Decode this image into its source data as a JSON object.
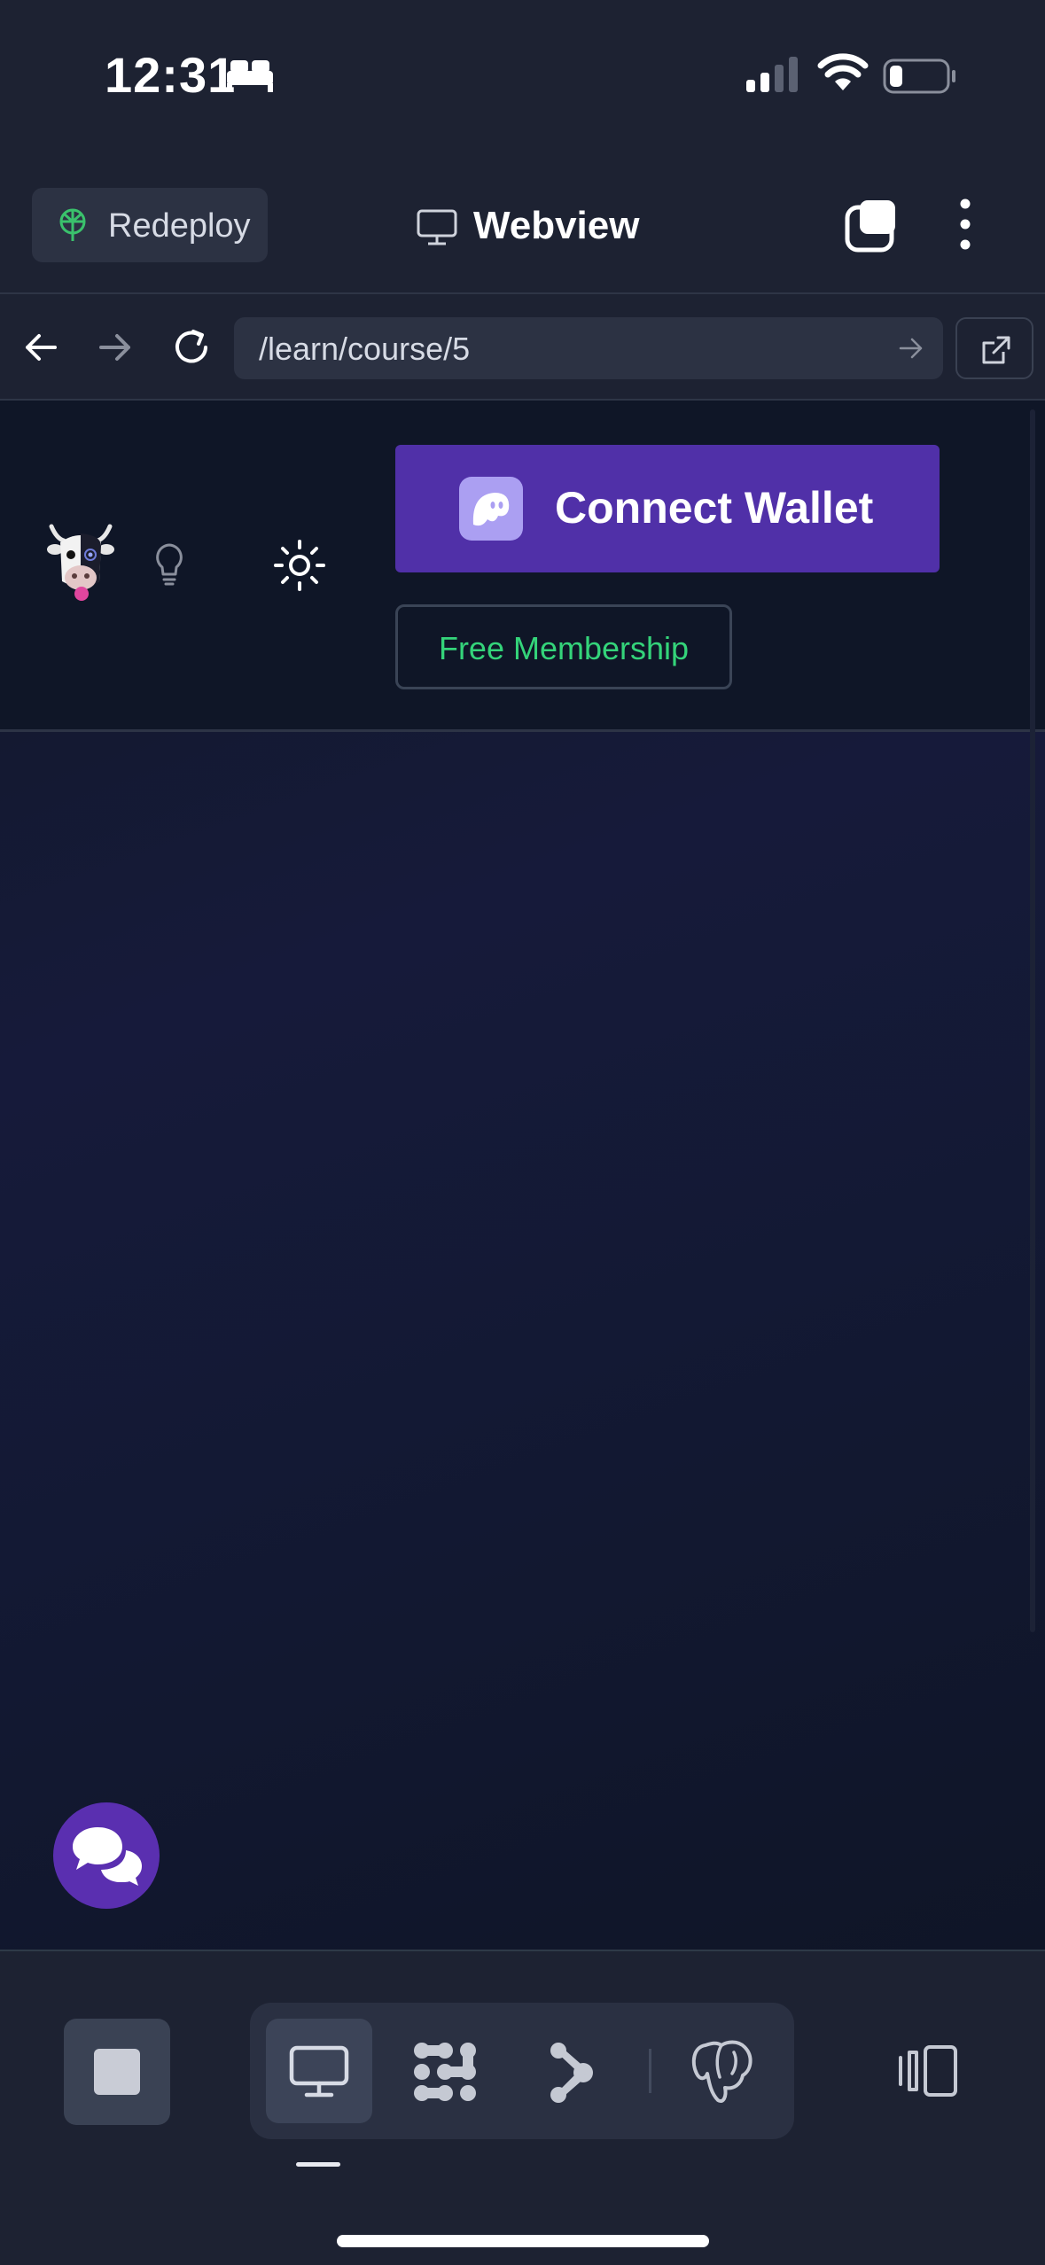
{
  "status_bar": {
    "time": "12:31",
    "focus_icon": "bed-icon",
    "signal_icon": "cellular-signal-icon",
    "wifi_icon": "wifi-icon",
    "battery_icon": "battery-low-icon"
  },
  "app_bar": {
    "redeploy_label": "Redeploy",
    "title": "Webview",
    "title_icon": "monitor-icon",
    "tabs_icon": "tabs-icon",
    "menu_icon": "more-vertical-icon"
  },
  "url_bar": {
    "url": "/learn/course/5",
    "back_icon": "arrow-left-icon",
    "forward_icon": "arrow-right-icon",
    "reload_icon": "reload-icon",
    "open_external_icon": "external-link-icon"
  },
  "site": {
    "logo_icon": "cow-logo-icon",
    "bulb_icon": "lightbulb-icon",
    "theme_icon": "sun-icon",
    "connect_wallet_label": "Connect Wallet",
    "wallet_icon": "phantom-ghost-icon",
    "free_membership_label": "Free Membership",
    "chat_icon": "chat-bubbles-icon",
    "colors": {
      "connect_wallet_bg": "#5030a8",
      "membership_text": "#34d47a",
      "chat_fab_bg": "#5a2fb0"
    }
  },
  "bottom_bar": {
    "stop_icon": "stop-icon",
    "tools": [
      "webview-icon",
      "workflows-icon",
      "git-icon",
      "postgres-icon"
    ],
    "active_tool": "webview-icon",
    "panels_icon": "panels-icon"
  }
}
